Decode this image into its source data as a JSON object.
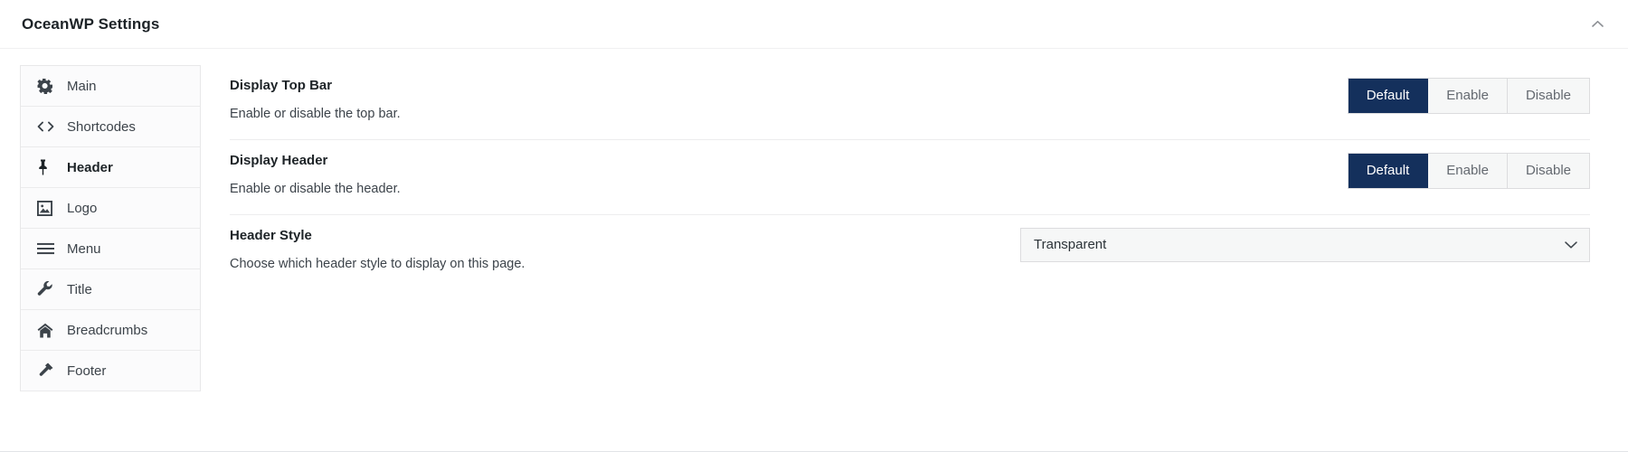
{
  "metabox": {
    "title": "OceanWP Settings",
    "collapse_icon": "chevron-up-icon"
  },
  "sidebar": {
    "items": [
      {
        "label": "Main",
        "icon": "gear-icon",
        "active": false
      },
      {
        "label": "Shortcodes",
        "icon": "code-icon",
        "active": false
      },
      {
        "label": "Header",
        "icon": "pin-icon",
        "active": true
      },
      {
        "label": "Logo",
        "icon": "image-icon",
        "active": false
      },
      {
        "label": "Menu",
        "icon": "hamburger-icon",
        "active": false
      },
      {
        "label": "Title",
        "icon": "wrench-icon",
        "active": false
      },
      {
        "label": "Breadcrumbs",
        "icon": "home-icon",
        "active": false
      },
      {
        "label": "Footer",
        "icon": "hammer-icon",
        "active": false
      }
    ]
  },
  "panel": {
    "fields": [
      {
        "title": "Display Top Bar",
        "description": "Enable or disable the top bar.",
        "control": "button-group",
        "options": [
          "Default",
          "Enable",
          "Disable"
        ],
        "selected": "Default"
      },
      {
        "title": "Display Header",
        "description": "Enable or disable the header.",
        "control": "button-group",
        "options": [
          "Default",
          "Enable",
          "Disable"
        ],
        "selected": "Default"
      },
      {
        "title": "Header Style",
        "description": "Choose which header style to display on this page.",
        "control": "select",
        "selected": "Transparent",
        "chevron_icon": "chevron-down-icon"
      }
    ]
  },
  "colors": {
    "accent": "#14305c",
    "control_bg": "#f6f7f7",
    "border": "#dcdcde",
    "text": "#1d2327",
    "muted_text": "#3c434a"
  }
}
